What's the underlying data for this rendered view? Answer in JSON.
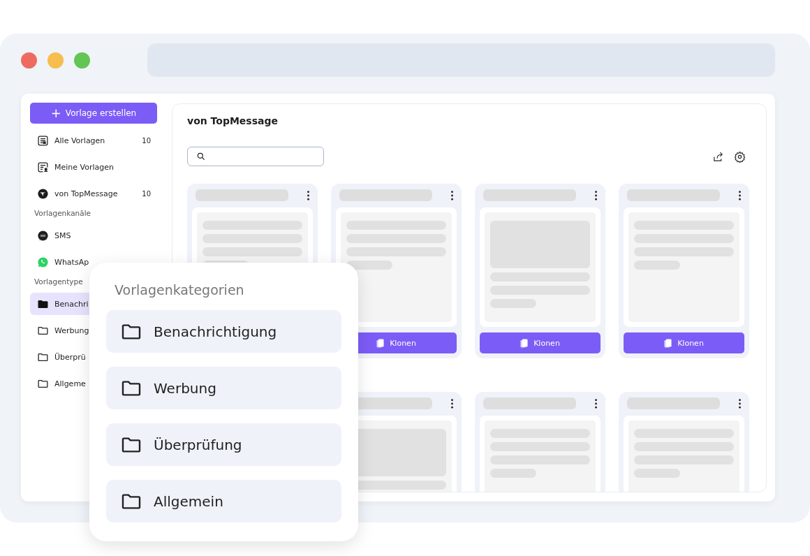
{
  "sidebar": {
    "create_button": {
      "icon": "+",
      "label": "Vorlage erstellen"
    },
    "sections": [
      {
        "items": [
          {
            "kind": "all",
            "label": "Alle Vorlagen",
            "count": "10",
            "selected": false
          },
          {
            "kind": "mine",
            "label": "Meine Vorlagen",
            "selected": false
          },
          {
            "kind": "brand",
            "label": "von TopMessage",
            "count": "10",
            "selected": false
          }
        ]
      },
      {
        "heading": "Vorlagenkanäle",
        "items": [
          {
            "kind": "sms",
            "label": "SMS",
            "selected": false
          },
          {
            "kind": "whatsapp",
            "label": "WhatsAp",
            "selected": false
          }
        ]
      },
      {
        "heading": "Vorlagentype",
        "items": [
          {
            "kind": "folder",
            "label": "Benachri",
            "selected": true
          },
          {
            "kind": "folder",
            "label": "Werbung",
            "selected": false
          },
          {
            "kind": "folder",
            "label": "Überprü",
            "selected": false
          },
          {
            "kind": "folder",
            "label": "Allgeme",
            "selected": false
          }
        ]
      }
    ]
  },
  "main": {
    "title": "von TopMessage",
    "cards": [
      {
        "kind": "text"
      },
      {
        "kind": "text",
        "button": "Klonen"
      },
      {
        "kind": "image",
        "button": "Klonen"
      },
      {
        "kind": "text",
        "button": "Klonen"
      },
      {
        "kind": "banner"
      },
      {
        "kind": "text"
      },
      {
        "kind": "text"
      }
    ]
  },
  "popup": {
    "title": "Vorlagenkategorien",
    "items": [
      {
        "label": "Benachrichtigung"
      },
      {
        "label": "Werbung"
      },
      {
        "label": "Überprüfung"
      },
      {
        "label": "Allgemein"
      }
    ]
  }
}
